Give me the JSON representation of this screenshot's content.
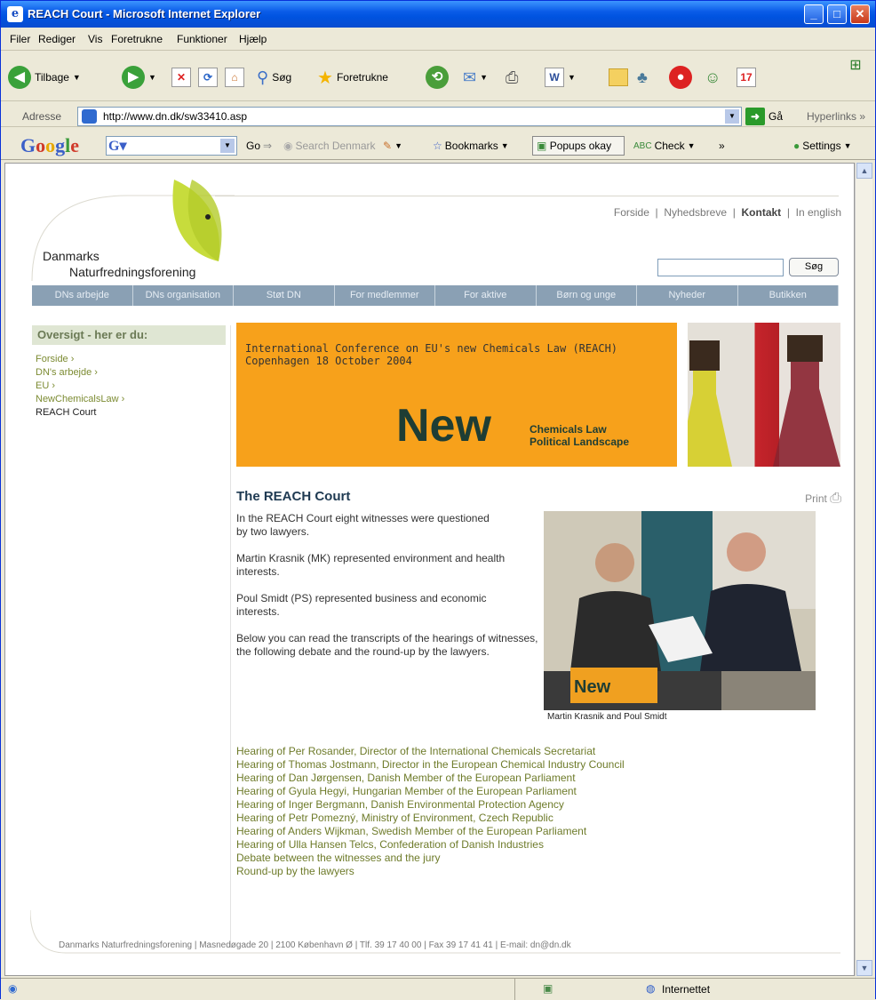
{
  "window": {
    "title": "REACH Court - Microsoft Internet Explorer"
  },
  "menu": [
    "Filer",
    "Rediger",
    "Vis",
    "Foretrukne",
    "Funktioner",
    "Hjælp"
  ],
  "toolbar": {
    "back_label": "Tilbage",
    "search_label": "Søg",
    "favorites_label": "Foretrukne"
  },
  "address": {
    "label": "Adresse",
    "url": "http://www.dn.dk/sw33410.asp",
    "go_label": "Gå",
    "links_label": "Hyperlinks"
  },
  "google_bar": {
    "logo": "Google",
    "go_label": "Go",
    "search_denmark": "Search Denmark",
    "bookmarks_label": "Bookmarks",
    "popups_label": "Popups okay",
    "check_label": "Check",
    "settings_label": "Settings"
  },
  "site": {
    "logo_line1": "Danmarks",
    "logo_line2": "Naturfredningsforening",
    "top_links": [
      "Forside",
      "Nyhedsbreve",
      "Kontakt",
      "In english"
    ],
    "search_button": "Søg",
    "nav": [
      "DNs arbejde",
      "DNs organisation",
      "Støt DN",
      "For medlemmer",
      "For aktive",
      "Børn og unge",
      "Nyheder",
      "Butikken"
    ],
    "sidebar_title": "Oversigt - her er du:",
    "breadcrumbs": [
      "Forside ›",
      "DN's arbejde ›",
      "EU ›",
      "NewChemicalsLaw ›",
      "REACH Court"
    ]
  },
  "banner": {
    "line1": "International Conference on EU's new Chemicals Law (REACH)",
    "line2": "Copenhagen 18 October 2004",
    "big": "New",
    "sub1": "Chemicals Law",
    "sub2": "Political Landscape"
  },
  "article": {
    "title": "The REACH Court",
    "print_label": "Print",
    "paragraphs": [
      "In the REACH Court eight witnesses were questioned by two lawyers.",
      "Martin Krasnik (MK) represented environment and health interests.",
      "Poul Smidt (PS) represented business and economic interests.",
      "Below you can read the transcripts of the hearings of witnesses, the following debate and the round-up by the lawyers."
    ],
    "photo_caption": "Martin Krasnik and Poul Smidt",
    "photo_sign": "New"
  },
  "hearings": [
    "Hearing of Per Rosander, Director of the International Chemicals Secretariat",
    "Hearing of Thomas Jostmann, Director in the European Chemical Industry Council",
    "Hearing of Dan Jørgensen, Danish Member of the European Parliament",
    "Hearing of Gyula Hegyi, Hungarian Member of the European Parliament",
    "Hearing of Inger Bergmann, Danish Environmental Protection Agency",
    "Hearing of Petr Pomezný, Ministry of Environment, Czech Republic",
    "Hearing of Anders Wijkman, Swedish Member of the European Parliament",
    "Hearing of Ulla Hansen Telcs, Confederation of Danish Industries",
    "Debate between the witnesses and the jury",
    "Round-up by the lawyers"
  ],
  "footer": "Danmarks Naturfredningsforening  |  Masnedøgade 20  |  2100 København Ø  |  Tlf. 39 17 40 00  |  Fax 39 17 41 41  |  E-mail: dn@dn.dk",
  "status": {
    "zone": "Internettet"
  }
}
